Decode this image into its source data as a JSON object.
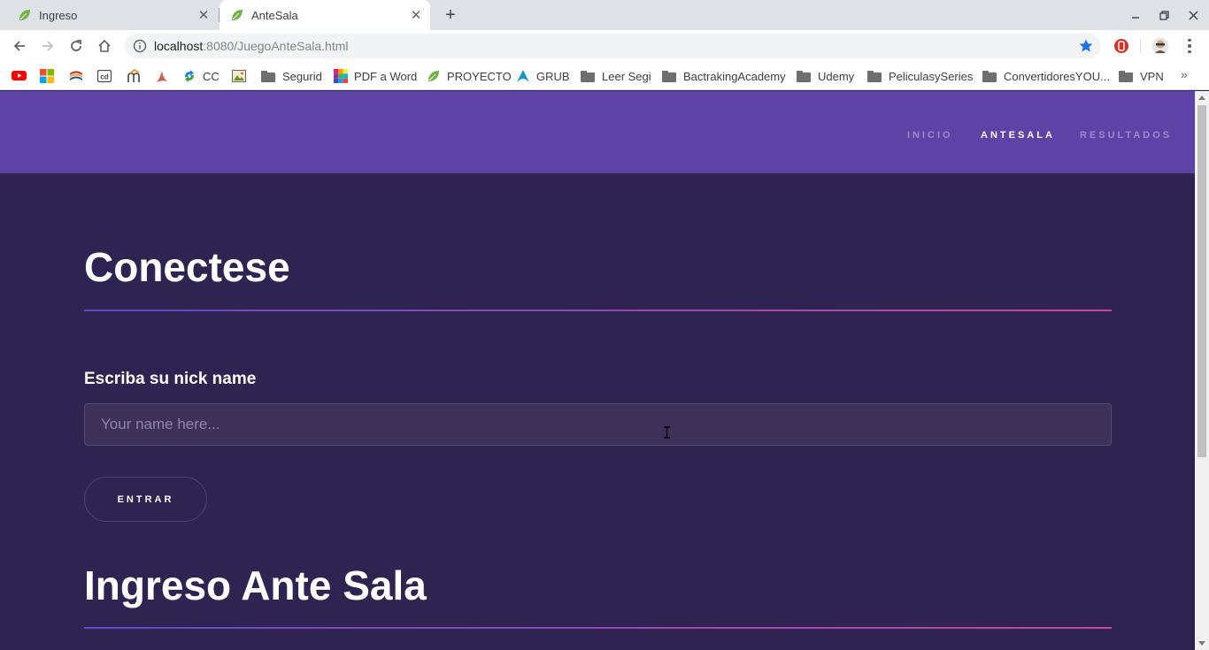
{
  "browser": {
    "tabs": [
      {
        "title": "Ingreso",
        "active": false
      },
      {
        "title": "AnteSala",
        "active": true
      }
    ],
    "address": {
      "host": "localhost",
      "path": ":8080/JuegoAnteSala.html"
    },
    "bookmarks": [
      {
        "label": "CC",
        "icon": "globe-icon"
      },
      {
        "label": "Segurid",
        "icon": "folder-icon"
      },
      {
        "label": "PDF a Word",
        "icon": "pdf-converter-icon"
      },
      {
        "label": "PROYECTO",
        "icon": "leaf-icon"
      },
      {
        "label": "GRUB",
        "icon": "arch-icon"
      },
      {
        "label": "Leer Segi",
        "icon": "folder-icon"
      },
      {
        "label": "BactrakingAcademy",
        "icon": "folder-icon"
      },
      {
        "label": "Udemy",
        "icon": "folder-icon"
      },
      {
        "label": "PeliculasySeries",
        "icon": "folder-icon"
      },
      {
        "label": "ConvertidoresYOU...",
        "icon": "folder-icon"
      },
      {
        "label": "VPN",
        "icon": "folder-icon"
      }
    ],
    "more_bookmarks": "»"
  },
  "site": {
    "nav": [
      {
        "label": "INICIO",
        "active": false
      },
      {
        "label": "ANTESALA",
        "active": true
      },
      {
        "label": "RESULTADOS",
        "active": false
      }
    ],
    "connect_title": "Conectese",
    "nick_label": "Escriba su nick name",
    "nick_placeholder": "Your name here...",
    "enter_button": "ENTRAR",
    "lobby_title": "Ingreso Ante Sala"
  },
  "colors": {
    "header": "#5e43a6",
    "page_bg": "#2e2351",
    "line_start": "#5e4bc7",
    "line_end": "#c24a9a"
  }
}
